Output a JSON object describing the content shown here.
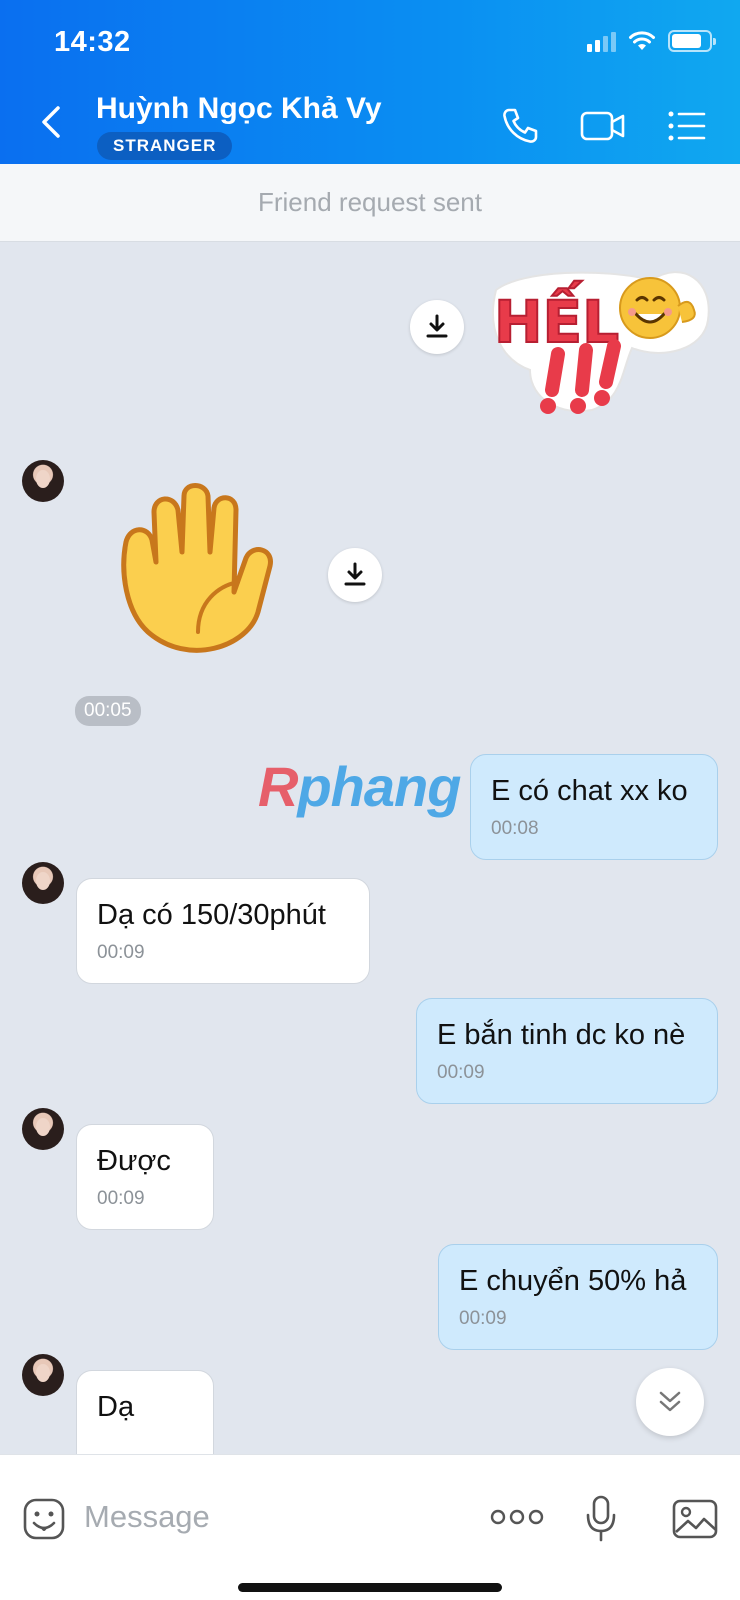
{
  "status": {
    "time": "14:32"
  },
  "header": {
    "name": "Huỳnh Ngọc Khả Vy",
    "badge": "STRANGER"
  },
  "banner": {
    "text": "Friend request sent"
  },
  "stickers": {
    "hello_text": "HẾL",
    "wave_time": "00:05"
  },
  "watermark": {
    "first": "R",
    "rest": "phang"
  },
  "messages": [
    {
      "side": "out",
      "text": "E có chat xx ko",
      "time": "00:08"
    },
    {
      "side": "in",
      "text": "Dạ có 150/30phút",
      "time": "00:09"
    },
    {
      "side": "out",
      "text": "E bắn tinh dc ko nè",
      "time": "00:09"
    },
    {
      "side": "in",
      "text": "Được",
      "time": "00:09"
    },
    {
      "side": "out",
      "text": "E chuyển 50% hả",
      "time": "00:09"
    },
    {
      "side": "in",
      "text": "Dạ",
      "time": ""
    }
  ],
  "input": {
    "placeholder": "Message"
  }
}
